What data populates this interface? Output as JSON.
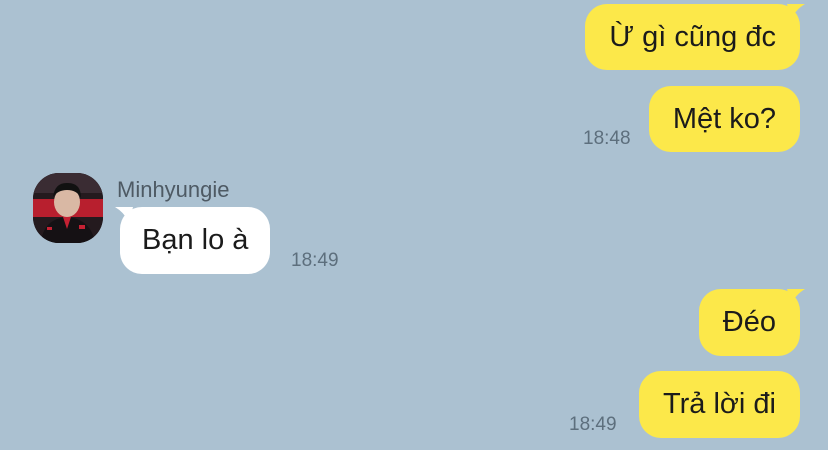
{
  "chat": {
    "colors": {
      "background": "#abc1d1",
      "outgoing_bubble": "#fce84a",
      "incoming_bubble": "#ffffff"
    },
    "contact": {
      "name": "Minhyungie",
      "avatar_icon": "profile-photo-icon"
    },
    "messages": [
      {
        "direction": "outgoing",
        "text": "Ừ gì cũng đc",
        "time": ""
      },
      {
        "direction": "outgoing",
        "text": "Mệt ko?",
        "time": "18:48"
      },
      {
        "direction": "incoming",
        "text": "Bạn lo à",
        "time": "18:49"
      },
      {
        "direction": "outgoing",
        "text": "Đéo",
        "time": ""
      },
      {
        "direction": "outgoing",
        "text": "Trả lời đi",
        "time": "18:49"
      }
    ]
  }
}
